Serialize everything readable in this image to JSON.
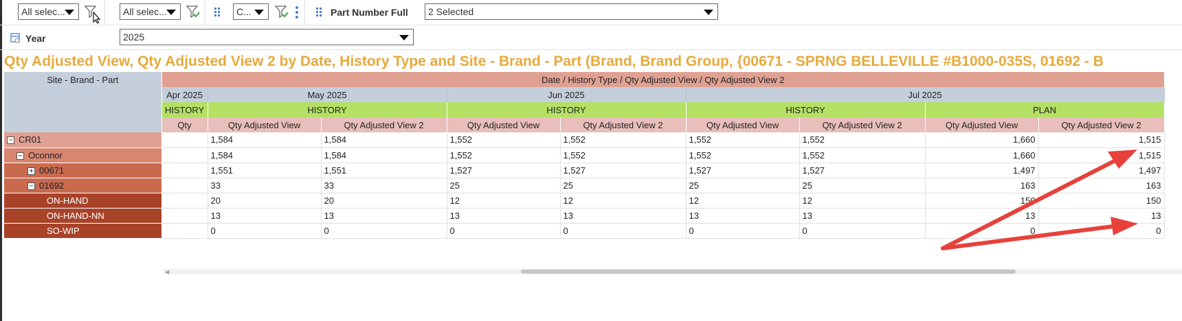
{
  "filters": {
    "filter1": {
      "value": "All selec..."
    },
    "filter2": {
      "value": "All selec..."
    },
    "filter3": {
      "value": "C..."
    },
    "part_number": {
      "label": "Part Number Full",
      "value": "2 Selected"
    },
    "year": {
      "label": "Year",
      "value": "2025"
    }
  },
  "title": "Qty Adjusted View, Qty Adjusted View 2 by Date, History Type and Site - Brand - Part (Brand, Brand Group, {00671 - SPRNG BELLEVILLE #B1000-035S, 01692 - B",
  "pivot": {
    "corner_label": "Site - Brand - Part",
    "top_header": "Date / History Type / Qty Adjusted View / Qty Adjusted View 2",
    "dates": [
      "Apr 2025",
      "May 2025",
      "Jun 2025",
      "Jul 2025"
    ],
    "types": [
      "HISTORY",
      "HISTORY",
      "HISTORY",
      "HISTORY",
      "PLAN"
    ],
    "measures": [
      "Qty",
      "Qty Adjusted View",
      "Qty Adjusted View 2",
      "Qty Adjusted View",
      "Qty Adjusted View 2",
      "Qty Adjusted View",
      "Qty Adjusted View 2",
      "Qty Adjusted View",
      "Qty Adjusted View 2"
    ],
    "rows": [
      {
        "label": "CR01",
        "toggle": "−",
        "cells": [
          "",
          "1,584",
          "1,584",
          "1,552",
          "1,552",
          "1,552",
          "1,552",
          "1,660",
          "1,515"
        ]
      },
      {
        "label": "Oconnor",
        "toggle": "−",
        "cells": [
          "",
          "1,584",
          "1,584",
          "1,552",
          "1,552",
          "1,552",
          "1,552",
          "1,660",
          "1,515"
        ]
      },
      {
        "label": "00671",
        "toggle": "+",
        "cells": [
          "",
          "1,551",
          "1,551",
          "1,527",
          "1,527",
          "1,527",
          "1,527",
          "1,497",
          "1,497"
        ]
      },
      {
        "label": "01692",
        "toggle": "−",
        "cells": [
          "",
          "33",
          "33",
          "25",
          "25",
          "25",
          "25",
          "163",
          "163"
        ]
      },
      {
        "label": "ON-HAND",
        "toggle": "",
        "cells": [
          "",
          "20",
          "20",
          "12",
          "12",
          "12",
          "12",
          "150",
          "150"
        ]
      },
      {
        "label": "ON-HAND-NN",
        "toggle": "",
        "cells": [
          "",
          "13",
          "13",
          "13",
          "13",
          "13",
          "13",
          "13",
          "13"
        ]
      },
      {
        "label": "SO-WIP",
        "toggle": "",
        "cells": [
          "",
          "0",
          "0",
          "0",
          "0",
          "0",
          "0",
          "0",
          "0"
        ]
      }
    ]
  },
  "colors": {
    "title": "#e8a93b",
    "header_salmon": "#e0a193",
    "header_green": "#b4e064",
    "header_blue": "#c5cfdb",
    "annotation_arrow": "#e8413c"
  },
  "icons": [
    "filter-icon",
    "filter-check-icon",
    "drag-grid-icon",
    "more-vertical-icon",
    "calendar-icon",
    "mouse-cursor-icon"
  ]
}
